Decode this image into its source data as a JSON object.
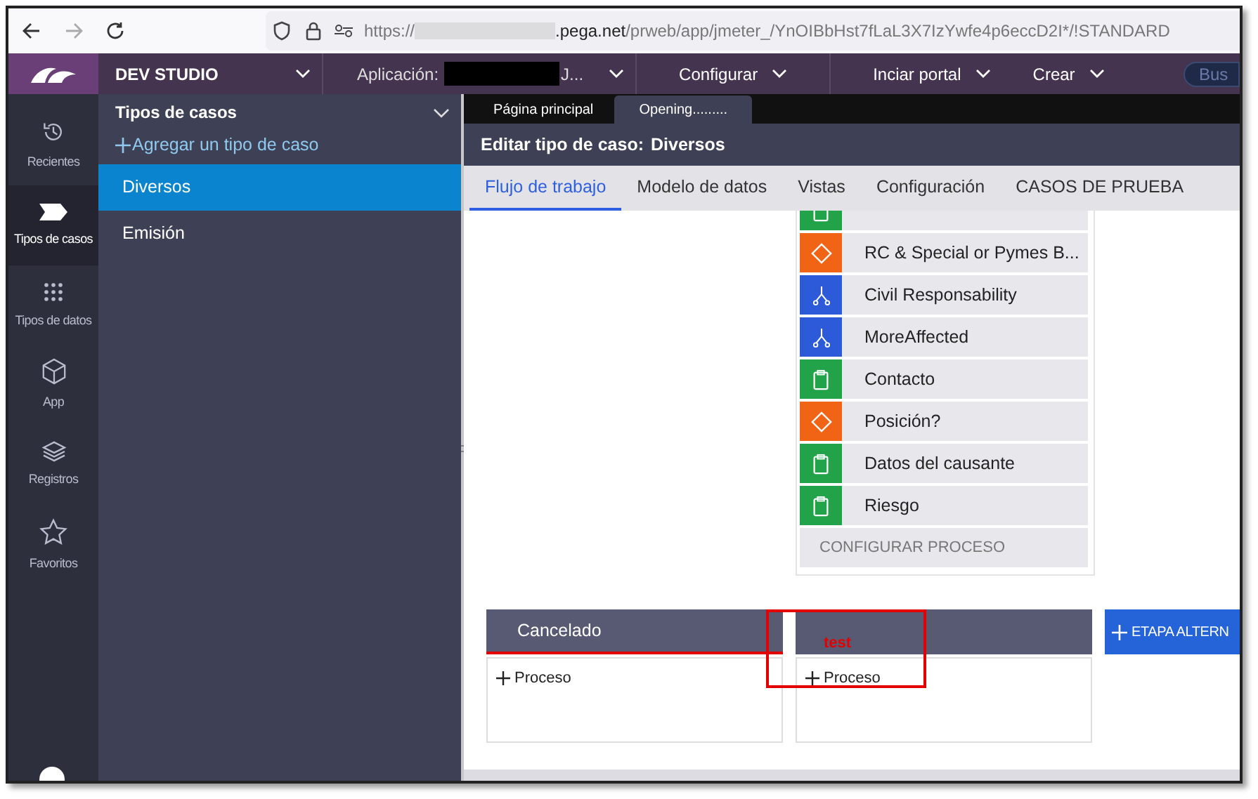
{
  "browser": {
    "url_start": "https://",
    "url_rest": ".pega.net/prweb/app/jmeter_/YnOIBbHst7fLaL3X7IzYwfe4p6eccD2I*/!STANDARD"
  },
  "top_nav": {
    "studio": "DEV STUDIO",
    "application_label": "Aplicación:",
    "application_value": "J...",
    "menus": [
      "Configurar",
      "Inciar portal",
      "Crear"
    ],
    "search_placeholder": "Bus"
  },
  "rail": [
    {
      "label": "Recientes",
      "selected": false
    },
    {
      "label": "Tipos de casos",
      "selected": true
    },
    {
      "label": "Tipos de datos",
      "selected": false
    },
    {
      "label": "App",
      "selected": false
    },
    {
      "label": "Registros",
      "selected": false
    },
    {
      "label": "Favoritos",
      "selected": false
    }
  ],
  "explorer": {
    "title": "Tipos de casos",
    "add_link": "Agregar un tipo de caso",
    "items": [
      {
        "label": "Diversos",
        "selected": true
      },
      {
        "label": "Emisión",
        "selected": false
      }
    ]
  },
  "doc_tabs": [
    {
      "label": "Página principal",
      "selected": false
    },
    {
      "label": "Opening.........",
      "selected": true
    }
  ],
  "header": {
    "label": "Editar tipo de caso:",
    "value": "Diversos"
  },
  "tabs": [
    {
      "label": "Flujo de trabajo",
      "selected": true
    },
    {
      "label": "Modelo de datos",
      "selected": false
    },
    {
      "label": "Vistas",
      "selected": false
    },
    {
      "label": "Configuración",
      "selected": false
    },
    {
      "label": "CASOS DE PRUEBA",
      "selected": false
    }
  ],
  "process_steps": [
    {
      "kind": "assignment"
    },
    {
      "kind": "decision",
      "label": "RC & Special or Pymes B..."
    },
    {
      "kind": "subprocess",
      "label": "Civil Responsability"
    },
    {
      "kind": "subprocess",
      "label": "MoreAffected"
    },
    {
      "kind": "assignment",
      "label": "Contacto"
    },
    {
      "kind": "decision",
      "label": "Posición?"
    },
    {
      "kind": "assignment",
      "label": "Datos del causante"
    },
    {
      "kind": "assignment",
      "label": "Riesgo"
    }
  ],
  "configure_process": "CONFIGURAR PROCESO",
  "stages": [
    {
      "title": "Cancelado",
      "alternate": true,
      "add_process": "Proceso"
    },
    {
      "alternate": false,
      "add_process": "Proceso"
    }
  ],
  "add_stage_button": "ETAPA ALTERN",
  "annotation": {
    "text": "test"
  }
}
